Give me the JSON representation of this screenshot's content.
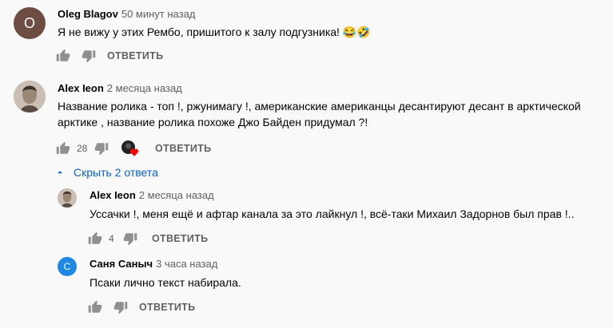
{
  "comments": [
    {
      "author": "Oleg Blagov",
      "time": "50 минут назад",
      "avatar_letter": "O",
      "avatar_color": "#6d4c41",
      "text": "Я не вижу у этих Рембо, пришитого к залу подгузника! 😂🤣",
      "reply_label": "ОТВЕТИТЬ"
    },
    {
      "author": "Alex Ieon",
      "time": "2 месяца назад",
      "text": "Название ролика - топ !, ржунимагу !, американские американцы десантируют десант в арктической арктике , название ролика похоже Джо Байден придумал ?!",
      "likes": "28",
      "reply_label": "ОТВЕТИТЬ",
      "replies_toggle": "Скрыть 2 ответа",
      "replies": [
        {
          "author": "Alex Ieon",
          "time": "2 месяца назад",
          "text": "Уссачки !, меня ещё и афтар канала за это лайкнул !, всё-таки Михаил Задорнов был прав !..",
          "likes": "4",
          "reply_label": "ОТВЕТИТЬ"
        },
        {
          "author": "Саня Саныч",
          "time": "3 часа назад",
          "avatar_letter": "С",
          "avatar_color": "#1e88e5",
          "text": "Псаки лично текст набирала.",
          "reply_label": "ОТВЕТИТЬ"
        }
      ]
    }
  ],
  "colors": {
    "link": "#065fd4",
    "heart": "#ff0000"
  }
}
